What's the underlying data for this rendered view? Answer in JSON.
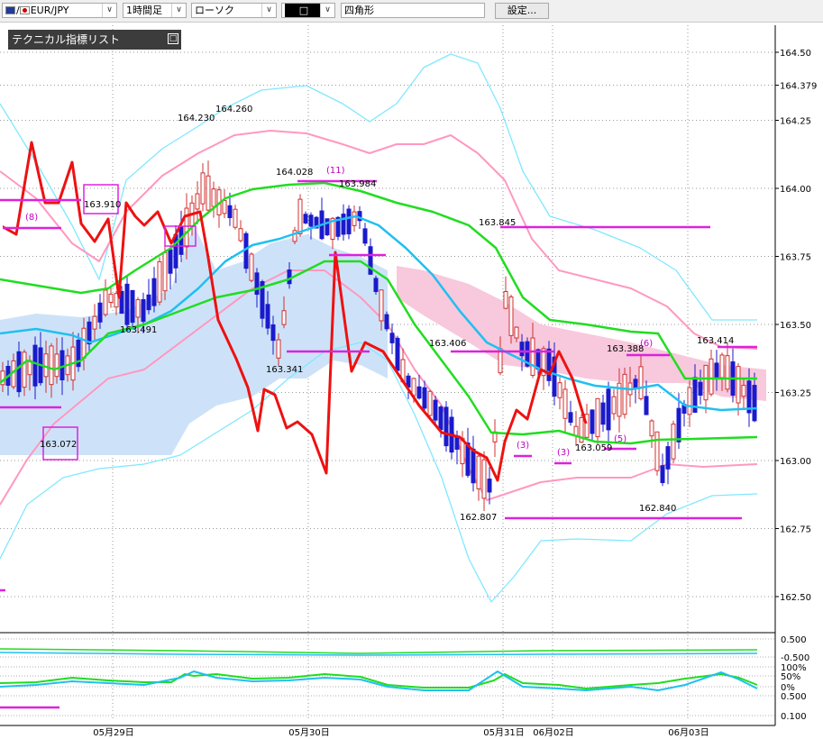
{
  "toolbar": {
    "symbol": "EUR/JPY",
    "symbol_separator": "/",
    "timeframe": "1時間足",
    "chart_style": "ローソク",
    "drawing_tool": "□",
    "drawing_name": "四角形",
    "settings_button": "設定..."
  },
  "indicator_panel": {
    "title": "テクニカル指標リスト",
    "toggle": "□"
  },
  "colors": {
    "bull": "#d03030",
    "bear": "#1a1acc",
    "ichimoku_cloud_bull": "#cde2f8",
    "ichimoku_cloud_bear": "#f8c8dc",
    "ma_short": "#20c0f0",
    "ma_long": "#20dd20",
    "bb_outer": "#80e8ff",
    "bb_inner": "#ff98c0",
    "red_line": "#ee1111",
    "marker": "#dd22dd"
  },
  "chart_data": {
    "type": "candlestick",
    "yticks": [
      "164.50",
      "164.379",
      "164.25",
      "164.00",
      "163.75",
      "163.50",
      "163.25",
      "163.00",
      "162.75",
      "162.50"
    ],
    "xticks": [
      "05月29日",
      "05月30日",
      "05月31日",
      "06月02日",
      "06月03日"
    ],
    "annotations": [
      "164.230",
      "164.260",
      "164.028",
      "163.984",
      "163.910",
      "163.845",
      "163.491",
      "163.406",
      "163.388",
      "163.414",
      "163.341",
      "163.072",
      "163.059",
      "162.807",
      "162.840"
    ],
    "counts": [
      "(8)",
      "(11)",
      "(6)",
      "(3)",
      "(3)",
      "(5)"
    ],
    "osc_labels": [
      "0.500",
      "-0.500",
      "100%",
      "50%",
      "0%",
      "0.500",
      "0.100"
    ]
  }
}
